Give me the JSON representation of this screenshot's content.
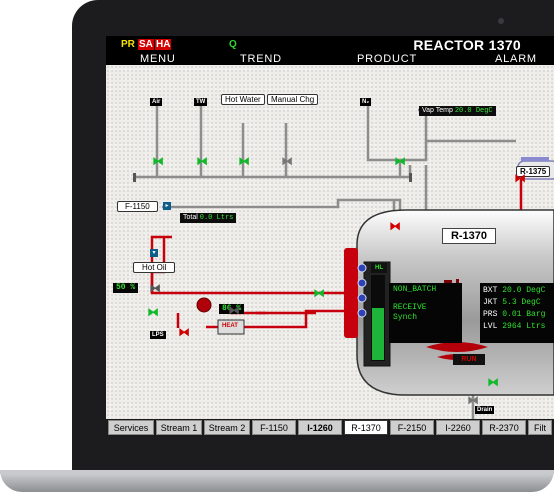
{
  "header": {
    "alarms": {
      "pr": "PR",
      "sa": "SA",
      "ha": "HA",
      "q": "Q"
    },
    "title": "REACTOR 1370",
    "menu": [
      "MENU",
      "TREND",
      "PRODUCT",
      "ALARM"
    ]
  },
  "lines": {
    "air": "Air",
    "tw": "TW",
    "hot_water": "Hot Water",
    "manual_chg": "Manual Chg",
    "n2": "N₂",
    "lps": "LPS",
    "drain": "Drain"
  },
  "vap_temp": {
    "label": "Vap Temp",
    "value": "20.0 DegC"
  },
  "f1150": {
    "label": "F-1150"
  },
  "total": {
    "label": "Total",
    "value": "0.0 Ltrs"
  },
  "hot_oil": {
    "label": "Hot Oil",
    "valve_pct": "50 %"
  },
  "control_valve_pct": "86 %",
  "heat_label": "HEAT",
  "r1375": "R-1375",
  "reactor": {
    "title": "R-1370",
    "hl": "HL",
    "status": [
      "NON_BATCH",
      "RECEIVE",
      "Synch"
    ],
    "values": [
      {
        "name": "BXT",
        "value": "20.0 DegC"
      },
      {
        "name": "JKT",
        "value": "5.3 DegC"
      },
      {
        "name": "PRS",
        "value": "0.01 Barg"
      },
      {
        "name": "LVL",
        "value": "2964 Ltrs"
      }
    ],
    "run": "RUN",
    "level_fraction": 0.62
  },
  "tabs": [
    "Services",
    "Stream 1",
    "Stream 2",
    "F-1150",
    "I-1260",
    "R-1370",
    "F-2150",
    "I-2260",
    "R-2370",
    "Filt"
  ],
  "active_tab": "R-1370",
  "colors": {
    "alarm_red": "#d40000",
    "green": "#2ee22e",
    "yellow": "#f6e200"
  }
}
